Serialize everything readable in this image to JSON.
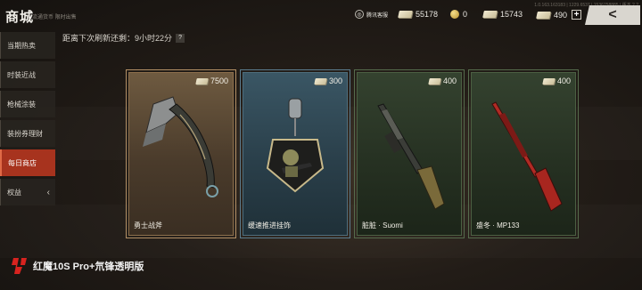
{
  "header": {
    "title": "商城",
    "subtitle": "流通货币 限时出售",
    "build_info": "1.0.163.163183 | 1229.6537 | 1536758885 | 版本 ? ?"
  },
  "currencies": [
    {
      "id": "tencent",
      "label": "腾讯客服",
      "icon": "circle-icon"
    },
    {
      "id": "ticket1",
      "value": "55178",
      "icon": "ticket-icon"
    },
    {
      "id": "gold",
      "value": "0",
      "icon": "gold-coin-icon"
    },
    {
      "id": "ticket2",
      "value": "15743",
      "icon": "ticket-icon"
    },
    {
      "id": "ticket3",
      "value": "490",
      "icon": "ticket-icon"
    }
  ],
  "plus_label": "+",
  "back_label": "<",
  "refresh": {
    "text": "距离下次刷新还剩：9小时22分",
    "help": "?"
  },
  "sidebar": {
    "items": [
      {
        "label": "当期热卖"
      },
      {
        "label": "时装近战"
      },
      {
        "label": "枪械涂装"
      },
      {
        "label": "装扮券理财"
      },
      {
        "label": "每日商店"
      },
      {
        "label": "权益",
        "chevron": "‹"
      }
    ],
    "active_index": 4
  },
  "cards": [
    {
      "name": "勇士战斧",
      "price": "7500",
      "rarity_color": "#b39066",
      "item_icon": "axe-icon"
    },
    {
      "name": "缓速推进挂饰",
      "price": "300",
      "rarity_color": "#5b7c8e",
      "item_icon": "charm-icon"
    },
    {
      "name": "脏脏 · Suomi",
      "price": "400",
      "rarity_color": "#556b4c",
      "item_icon": "smg-icon"
    },
    {
      "name": "盛冬 · MP133",
      "price": "400",
      "rarity_color": "#556b4c",
      "item_icon": "shotgun-icon"
    }
  ],
  "watermark": {
    "text": "红魔10S Pro+氘锋透明版"
  }
}
